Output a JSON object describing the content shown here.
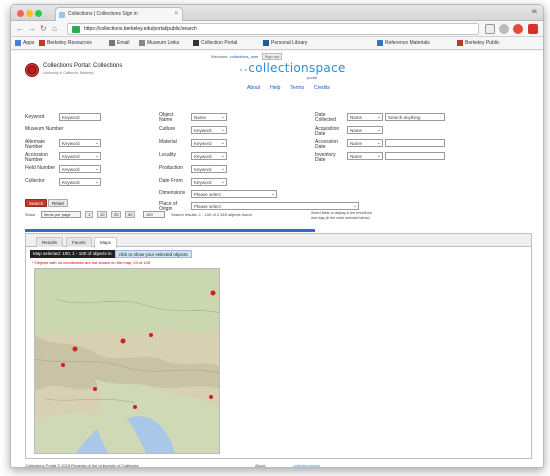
{
  "browser": {
    "tab_title": "Collections | Collections Sign in",
    "user_label": "dk",
    "url": "https://collections.berkeley.edu/portal/public/search",
    "bookmarks": [
      {
        "label": "Apps",
        "color": "#4a7fd4"
      },
      {
        "label": "Berkeley Resources",
        "color": "#c0392b"
      },
      {
        "label": "Email",
        "color": "#777"
      },
      {
        "label": "Museum Links",
        "color": "#888"
      },
      {
        "label": "Collection Portal",
        "color": "#333"
      },
      {
        "label": "Personal Library",
        "color": "#1f5a9b"
      },
      {
        "label": "Reference Materials",
        "color": "#3b73b9"
      },
      {
        "label": "Berkeley Public",
        "color": "#c0392b"
      }
    ]
  },
  "header": {
    "welcome_text": "Welcome,",
    "welcome_user": "collections_user",
    "signout_label": "Sign out",
    "museum_name": "Collections Portal: Collections",
    "museum_sub": "University of California, Berkeley",
    "brand_prefix": "∙∙",
    "brand": "collectionspace",
    "brand_sub": "portal",
    "nav": [
      "About",
      "Help",
      "Terms",
      "Credits"
    ]
  },
  "form": {
    "labels": {
      "keyword": "Keyword",
      "museum_number": "Museum Number",
      "alternate_number": "Alternate Number",
      "accession_number": "Accession Number",
      "field_number": "Field Number",
      "collector": "Collector",
      "object_name": "Object Name",
      "culture": "Culture",
      "material": "Material",
      "locality": "Locality",
      "production": "Production",
      "date_from": "Date From",
      "dimensions": "Dimensions",
      "place_of_origin": "Place of Origin",
      "date_collected": "Date Collected",
      "acquisition_date": "Acquisition Date",
      "accession_date": "Accession Date",
      "inventory_date": "Inventory Date"
    },
    "fields": {
      "keyword": "Keyword",
      "object_name": "Name",
      "culture": "Keyword",
      "material": "Keyword",
      "locality": "Keyword",
      "production": "Keyword",
      "date_from": "Keyword",
      "date_collected_1": "Name",
      "date_collected_2": "Search anything",
      "acquisition_date": "Name",
      "accession_date": "Name",
      "inventory_date": "Name",
      "alternate_number": "Keyword",
      "accession_number": "Keyword",
      "field_number": "Keyword",
      "collector": "Keyword",
      "dimensions": "Please select",
      "place_of_origin": "Please select"
    }
  },
  "actions": {
    "search_label": "Search",
    "reset_label": "Reset"
  },
  "results": {
    "label": "Show",
    "per_page": "Items per page",
    "pages": [
      "1",
      "10",
      "25",
      "50"
    ],
    "page_size": "100",
    "summary": "Search results: 1 - 100 of 2,345 objects found",
    "sort_hint_1": "Select fields to display in the results list",
    "sort_hint_2": "and map (in the order selected below)"
  },
  "view_tabs": [
    "Results",
    "Facets",
    "Maps"
  ],
  "map_header": {
    "dark": "Map selected: 100, 1 - 100 of objects in",
    "blue": "click to show your selected objects"
  },
  "map_warning": "* Objects with no coordinates are not shown on the map: 24 of 100",
  "status": {
    "left": "Collections Portal © 2015 Regents of the University of California",
    "mid": "About",
    "right": "collectionspace"
  }
}
